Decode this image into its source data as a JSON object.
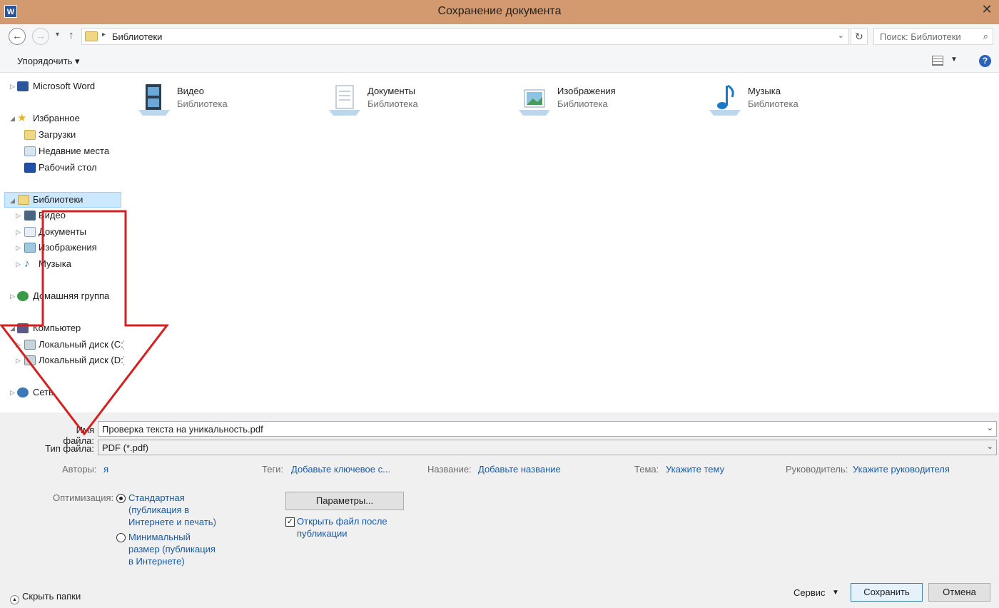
{
  "window": {
    "title": "Сохранение документа",
    "app_icon": "W",
    "close": "✕"
  },
  "nav": {
    "back": "←",
    "forward": "→",
    "up": "↑",
    "breadcrumb": "Библиотеки",
    "search_placeholder": "Поиск: Библиотеки"
  },
  "toolbar": {
    "organize": "Упорядочить ▾",
    "help": "?"
  },
  "tree": {
    "ms_word": "Microsoft Word",
    "favorites": "Избранное",
    "downloads": "Загрузки",
    "recent": "Недавние места",
    "desktop": "Рабочий стол",
    "libraries": "Библиотеки",
    "video": "Видео",
    "documents": "Документы",
    "images": "Изображения",
    "music": "Музыка",
    "homegroup": "Домашняя группа",
    "computer": "Компьютер",
    "disk_c": "Локальный диск (C:)",
    "disk_d": "Локальный диск (D:)",
    "network": "Сеть"
  },
  "libraries": [
    {
      "name": "Видео",
      "sub": "Библиотека",
      "icon": "video-library-icon"
    },
    {
      "name": "Документы",
      "sub": "Библиотека",
      "icon": "documents-library-icon"
    },
    {
      "name": "Изображения",
      "sub": "Библиотека",
      "icon": "images-library-icon"
    },
    {
      "name": "Музыка",
      "sub": "Библиотека",
      "icon": "music-library-icon"
    }
  ],
  "form": {
    "filename_label": "Имя файла:",
    "filename_value": "Проверка текста на уникальность.pdf",
    "filetype_label": "Тип файла:",
    "filetype_value": "PDF (*.pdf)",
    "authors_label": "Авторы:",
    "authors_value": "я",
    "tags_label": "Теги:",
    "tags_value": "Добавьте ключевое с...",
    "title_label": "Название:",
    "title_value": "Добавьте название",
    "subject_label": "Тема:",
    "subject_value": "Укажите тему",
    "manager_label": "Руководитель:",
    "manager_value": "Укажите руководителя",
    "optimize_label": "Оптимизация:",
    "opt_standard_1": "Стандартная",
    "opt_standard_2": "(публикация в",
    "opt_standard_3": "Интернете и печать)",
    "opt_min_1": "Минимальный",
    "opt_min_2": "размер (публикация",
    "opt_min_3": "в Интернете)",
    "params_button": "Параметры...",
    "open_after_1": "Открыть файл после",
    "open_after_2": "публикации",
    "hide_folders": "Скрыть папки",
    "service": "Сервис",
    "save": "Сохранить",
    "cancel": "Отмена"
  },
  "colors": {
    "titlebar": "#d39a6f",
    "link": "#1a5aa6",
    "selection": "#cce8ff",
    "annotation": "#d42020"
  }
}
